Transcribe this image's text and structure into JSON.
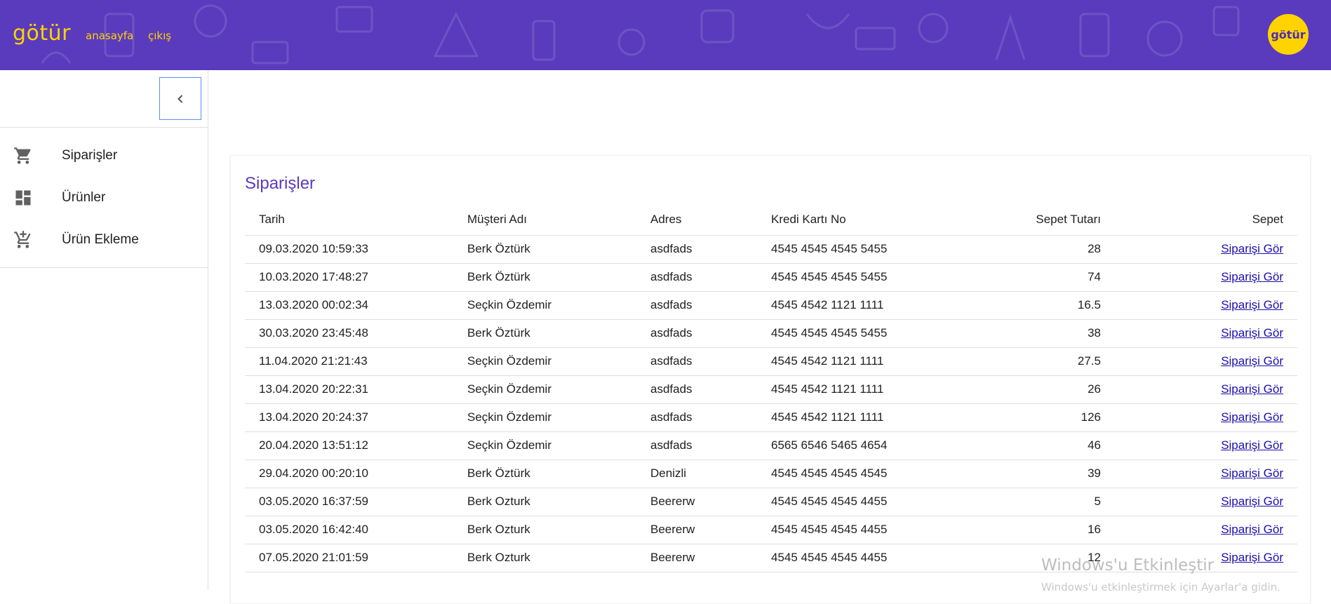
{
  "header": {
    "brand": "götür",
    "nav": {
      "home": "anasayfa",
      "logout": "çıkış"
    },
    "avatar_text": "götür",
    "background": "#5a3bbd",
    "accent": "#ffd300"
  },
  "sidebar": {
    "collapse_icon": "chevron-left-icon",
    "items": [
      {
        "label": "Siparişler",
        "icon": "cart-icon"
      },
      {
        "label": "Ürünler",
        "icon": "dashboard-icon"
      },
      {
        "label": "Ürün Ekleme",
        "icon": "add-to-cart-icon"
      }
    ]
  },
  "orders": {
    "title": "Siparişler",
    "columns": [
      "Tarih",
      "Müşteri Adı",
      "Adres",
      "Kredi Kartı No",
      "Sepet Tutarı",
      "Sepet"
    ],
    "link_color": "#1a0dab",
    "rows": [
      {
        "date": "09.03.2020 10:59:33",
        "customer": "Berk Öztürk",
        "address": "asdfads",
        "card": "4545 4545 4545 5455",
        "total": "28",
        "link": "Siparişi Gör"
      },
      {
        "date": "10.03.2020 17:48:27",
        "customer": "Berk Öztürk",
        "address": "asdfads",
        "card": "4545 4545 4545 5455",
        "total": "74",
        "link": "Siparişi Gör"
      },
      {
        "date": "13.03.2020 00:02:34",
        "customer": "Seçkin Özdemir",
        "address": "asdfads",
        "card": "4545 4542 1121 1111",
        "total": "16.5",
        "link": "Siparişi Gör"
      },
      {
        "date": "30.03.2020 23:45:48",
        "customer": "Berk Öztürk",
        "address": "asdfads",
        "card": "4545 4545 4545 5455",
        "total": "38",
        "link": "Siparişi Gör"
      },
      {
        "date": "11.04.2020 21:21:43",
        "customer": "Seçkin Özdemir",
        "address": "asdfads",
        "card": "4545 4542 1121 1111",
        "total": "27.5",
        "link": "Siparişi Gör"
      },
      {
        "date": "13.04.2020 20:22:31",
        "customer": "Seçkin Özdemir",
        "address": "asdfads",
        "card": "4545 4542 1121 1111",
        "total": "26",
        "link": "Siparişi Gör"
      },
      {
        "date": "13.04.2020 20:24:37",
        "customer": "Seçkin Özdemir",
        "address": "asdfads",
        "card": "4545 4542 1121 1111",
        "total": "126",
        "link": "Siparişi Gör"
      },
      {
        "date": "20.04.2020 13:51:12",
        "customer": "Seçkin Özdemir",
        "address": "asdfads",
        "card": "6565 6546 5465 4654",
        "total": "46",
        "link": "Siparişi Gör"
      },
      {
        "date": "29.04.2020 00:20:10",
        "customer": "Berk Öztürk",
        "address": "Denizli",
        "card": "4545 4545 4545 4545",
        "total": "39",
        "link": "Siparişi Gör"
      },
      {
        "date": "03.05.2020 16:37:59",
        "customer": "Berk Ozturk",
        "address": "Beererw",
        "card": "4545 4545 4545 4455",
        "total": "5",
        "link": "Siparişi Gör"
      },
      {
        "date": "03.05.2020 16:42:40",
        "customer": "Berk Ozturk",
        "address": "Beererw",
        "card": "4545 4545 4545 4455",
        "total": "16",
        "link": "Siparişi Gör"
      },
      {
        "date": "07.05.2020 21:01:59",
        "customer": "Berk Ozturk",
        "address": "Beererw",
        "card": "4545 4545 4545 4455",
        "total": "12",
        "link": "Siparişi Gör"
      }
    ]
  },
  "watermark": {
    "title": "Windows'u Etkinleştir",
    "subtitle": "Windows'u etkinleştirmek için Ayarlar'a gidin."
  }
}
